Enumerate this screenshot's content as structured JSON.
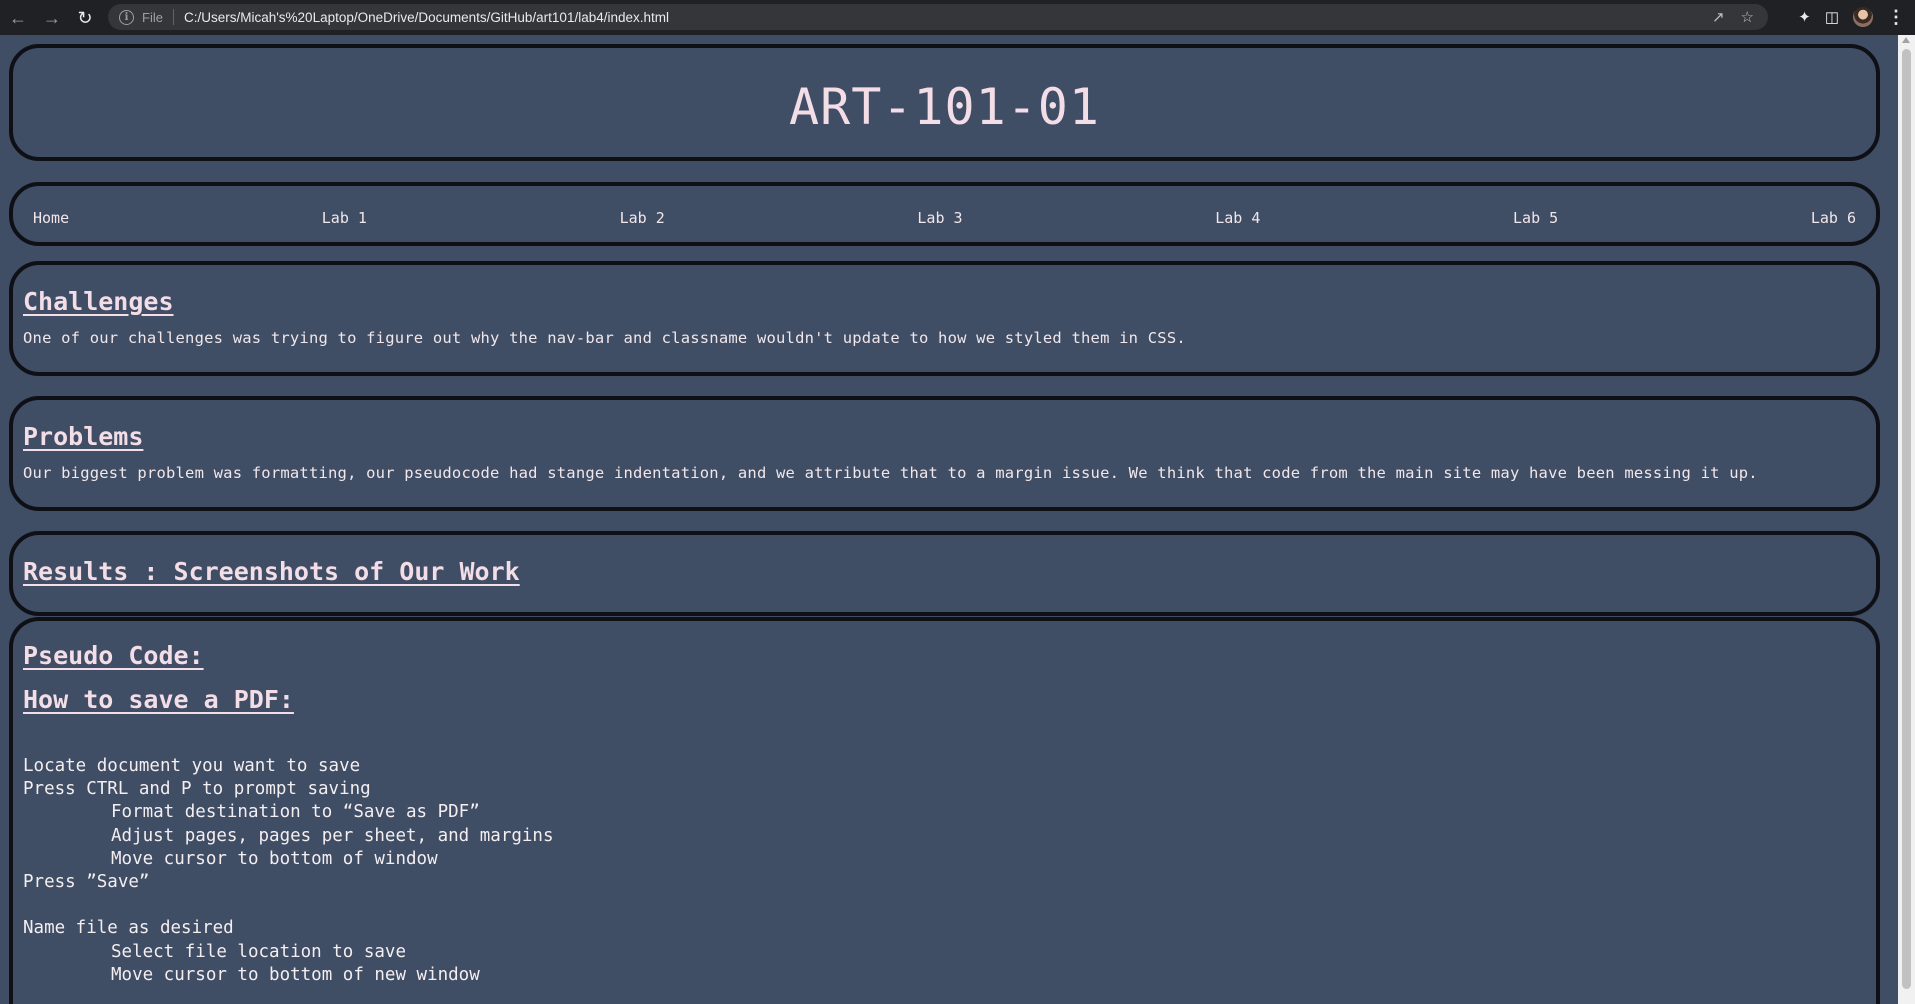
{
  "browser": {
    "scheme_label": "File",
    "url": "C:/Users/Micah's%20Laptop/OneDrive/Documents/GitHub/art101/lab4/index.html",
    "icons": [
      "back-icon",
      "forward-icon",
      "reload-icon",
      "info-icon",
      "share-icon",
      "star-icon",
      "extensions-icon",
      "side-panel-icon",
      "profile-avatar-icon",
      "menu-icon"
    ]
  },
  "header": {
    "title": "ART-101-01"
  },
  "nav": {
    "items": [
      "Home",
      "Lab 1",
      "Lab 2",
      "Lab 3",
      "Lab 4",
      "Lab 5",
      "Lab 6"
    ]
  },
  "challenges": {
    "title": "Challenges",
    "text": "One of our challenges was trying to figure out why the nav-bar and classname wouldn't update to how we styled them in CSS."
  },
  "problems": {
    "title": "Problems",
    "text": "Our biggest problem was formatting, our pseudocode had stange indentation, and we attribute that to a margin issue. We think that code from the main site may have been messing it up."
  },
  "results": {
    "title": "Results : Screenshots of Our Work"
  },
  "pseudo": {
    "title": "Pseudo Code:",
    "subtitle": "How to save a PDF:",
    "lines": [
      {
        "text": "Locate document you want to save",
        "indent": false
      },
      {
        "text": "Press CTRL and P to prompt saving",
        "indent": false
      },
      {
        "text": "Format destination to “Save as PDF”",
        "indent": true
      },
      {
        "text": "Adjust pages, pages per sheet, and margins",
        "indent": true
      },
      {
        "text": "Move cursor to bottom of window",
        "indent": true
      },
      {
        "text": "Press ”Save”",
        "indent": false
      },
      {
        "text": "",
        "indent": false
      },
      {
        "text": "Name file as desired",
        "indent": false
      },
      {
        "text": "Select file location to save",
        "indent": true
      },
      {
        "text": "Move cursor to bottom of new window",
        "indent": true
      }
    ]
  },
  "colors": {
    "page_background": "#3f4d65",
    "box_border": "#0f0f16",
    "text": "#f1e7ea",
    "chrome_background": "#202124"
  }
}
